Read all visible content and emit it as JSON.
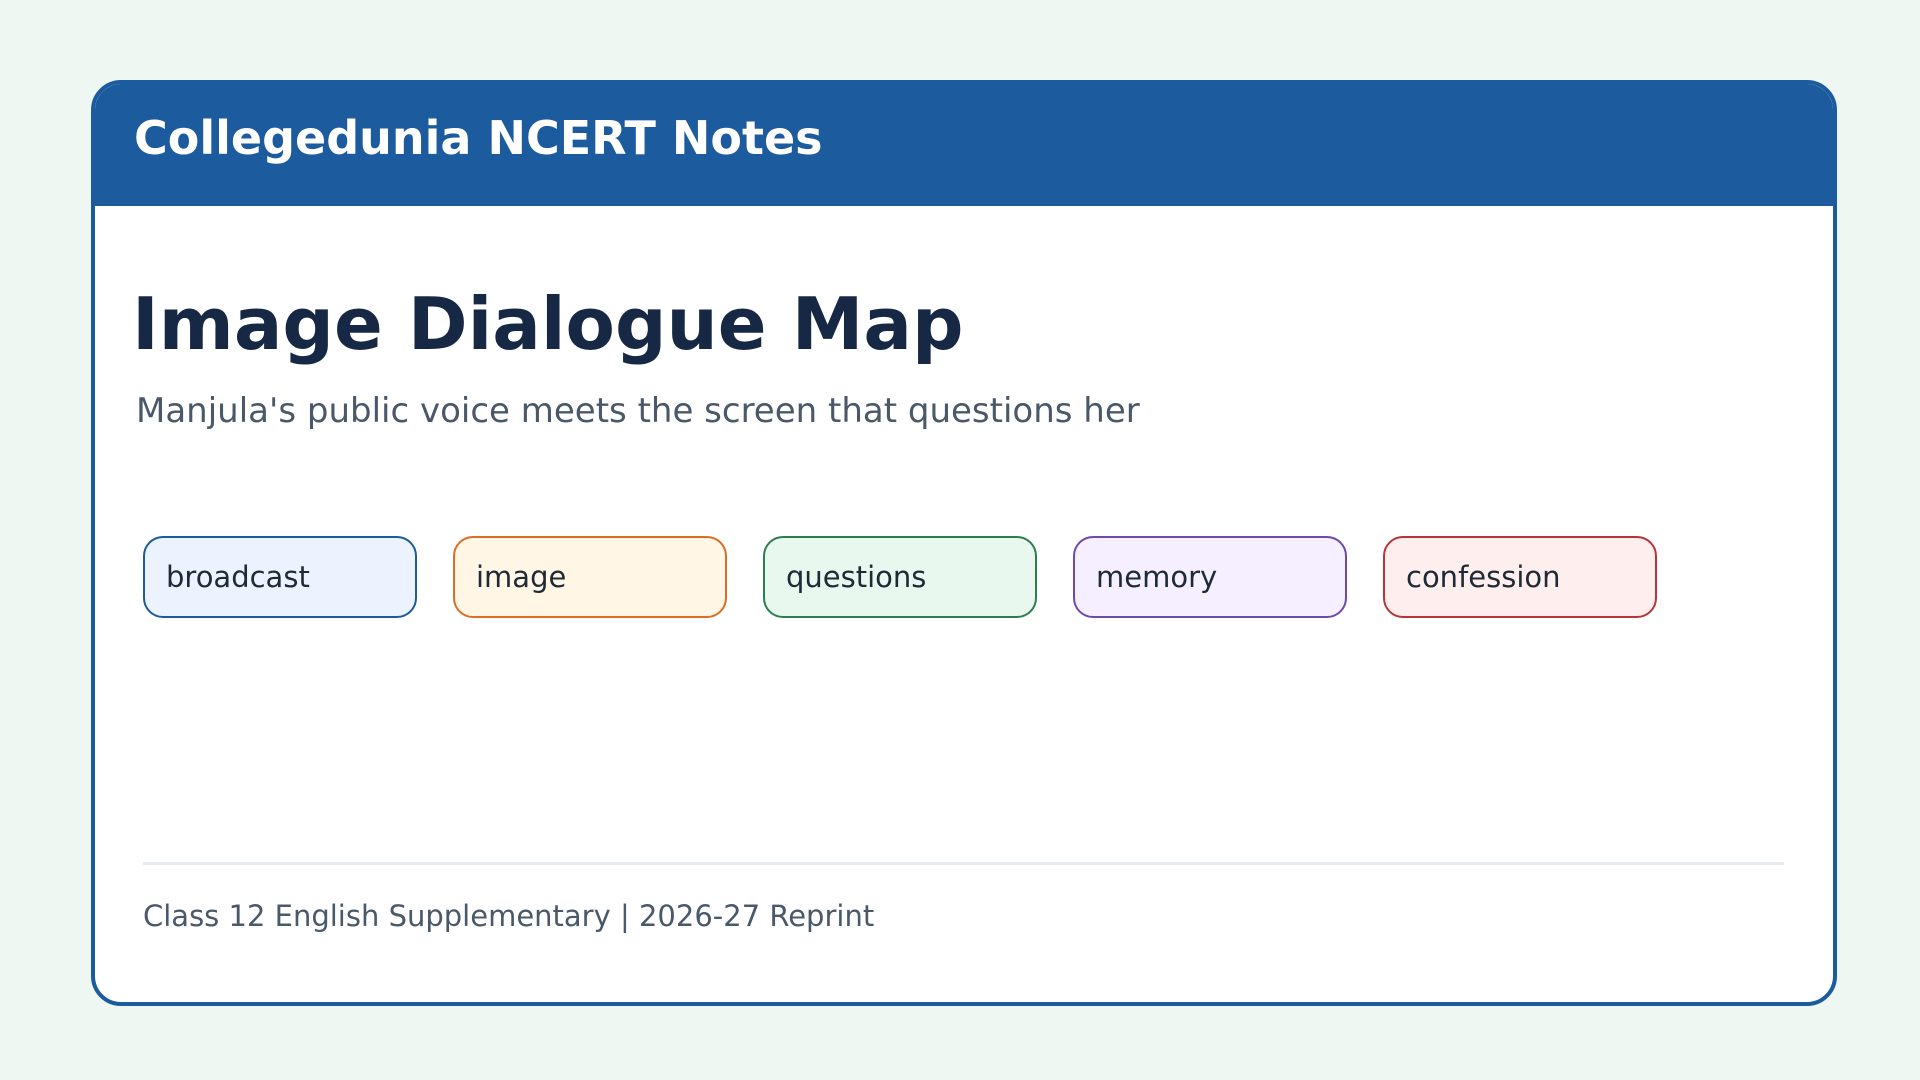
{
  "header": {
    "brand": "Collegedunia NCERT Notes"
  },
  "main": {
    "title": "Image Dialogue Map",
    "subtitle": "Manjula's public voice meets the screen that questions her",
    "tags": [
      {
        "label": "broadcast",
        "border_color": "#1d5b9f",
        "fill_color": "#ecf3ff"
      },
      {
        "label": "image",
        "border_color": "#d96f27",
        "fill_color": "#fff6e6"
      },
      {
        "label": "questions",
        "border_color": "#2e7d4f",
        "fill_color": "#e9f8ef"
      },
      {
        "label": "memory",
        "border_color": "#6f4aad",
        "fill_color": "#f5efff"
      },
      {
        "label": "confession",
        "border_color": "#b8343a",
        "fill_color": "#feeeee"
      }
    ]
  },
  "footer": {
    "text": "Class 12 English Supplementary | 2026-27 Reprint"
  },
  "colors": {
    "page_background": "#eff7f2",
    "accent": "#1d5b9f",
    "title_text": "#172844",
    "muted_text": "#4a5869"
  }
}
